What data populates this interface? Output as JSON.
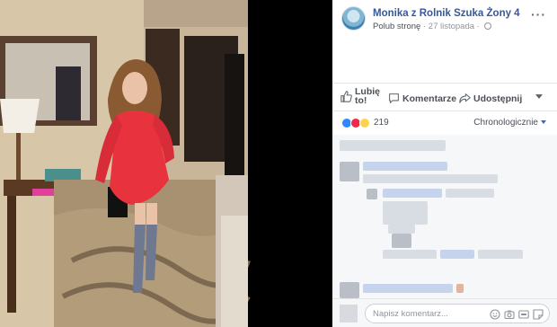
{
  "post": {
    "page_name": "Monika z Rolnik Szuka Żony 4",
    "like_page": "Polub stronę",
    "separator": "·",
    "date": "27 listopada",
    "more": "···"
  },
  "actions": {
    "like_line1": "Lubię",
    "like_line2": "to!",
    "comment": "Komentarze",
    "share": "Udostępnij"
  },
  "reactions": {
    "icons": [
      "like-icon",
      "love-icon",
      "wow-icon"
    ],
    "count": "219",
    "sort_label": "Chronologicznie"
  },
  "composer": {
    "placeholder": "Napisz komentarz..."
  },
  "colors": {
    "link": "#365899",
    "like": "#2e89ff",
    "love": "#f0284a",
    "wow": "#fcd34d",
    "dress": "#e8333f"
  }
}
